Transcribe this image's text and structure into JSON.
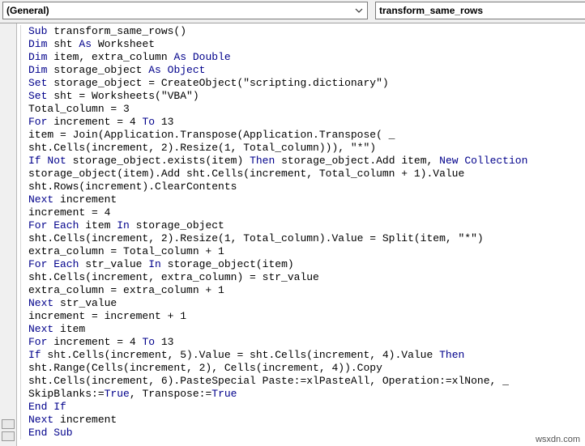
{
  "toolbar": {
    "object_combo_value": "(General)",
    "procedure_combo_value": "transform_same_rows"
  },
  "code_lines": [
    [
      {
        "t": "Sub",
        "k": true
      },
      {
        "t": " transform_same_rows()"
      }
    ],
    [
      {
        "t": "Dim",
        "k": true
      },
      {
        "t": " sht "
      },
      {
        "t": "As",
        "k": true
      },
      {
        "t": " Worksheet"
      }
    ],
    [
      {
        "t": "Dim",
        "k": true
      },
      {
        "t": " item, extra_column "
      },
      {
        "t": "As",
        "k": true
      },
      {
        "t": " "
      },
      {
        "t": "Double",
        "k": true
      }
    ],
    [
      {
        "t": "Dim",
        "k": true
      },
      {
        "t": " storage_object "
      },
      {
        "t": "As",
        "k": true
      },
      {
        "t": " "
      },
      {
        "t": "Object",
        "k": true
      }
    ],
    [
      {
        "t": "Set",
        "k": true
      },
      {
        "t": " storage_object = CreateObject(\"scripting.dictionary\")"
      }
    ],
    [
      {
        "t": "Set",
        "k": true
      },
      {
        "t": " sht = Worksheets(\"VBA\")"
      }
    ],
    [
      {
        "t": "Total_column = 3"
      }
    ],
    [
      {
        "t": "For",
        "k": true
      },
      {
        "t": " increment = 4 "
      },
      {
        "t": "To",
        "k": true
      },
      {
        "t": " 13"
      }
    ],
    [
      {
        "t": "item = Join(Application.Transpose(Application.Transpose( _"
      }
    ],
    [
      {
        "t": "sht.Cells(increment, 2).Resize(1, Total_column))), \"*\")"
      }
    ],
    [
      {
        "t": "If",
        "k": true
      },
      {
        "t": " "
      },
      {
        "t": "Not",
        "k": true
      },
      {
        "t": " storage_object.exists(item) "
      },
      {
        "t": "Then",
        "k": true
      },
      {
        "t": " storage_object.Add item, "
      },
      {
        "t": "New",
        "k": true
      },
      {
        "t": " "
      },
      {
        "t": "Collection",
        "k": true
      }
    ],
    [
      {
        "t": "storage_object(item).Add sht.Cells(increment, Total_column + 1).Value"
      }
    ],
    [
      {
        "t": "sht.Rows(increment).ClearContents"
      }
    ],
    [
      {
        "t": "Next",
        "k": true
      },
      {
        "t": " increment"
      }
    ],
    [
      {
        "t": "increment = 4"
      }
    ],
    [
      {
        "t": "For Each",
        "k": true
      },
      {
        "t": " item "
      },
      {
        "t": "In",
        "k": true
      },
      {
        "t": " storage_object"
      }
    ],
    [
      {
        "t": "sht.Cells(increment, 2).Resize(1, Total_column).Value = Split(item, \"*\")"
      }
    ],
    [
      {
        "t": "extra_column = Total_column + 1"
      }
    ],
    [
      {
        "t": "For Each",
        "k": true
      },
      {
        "t": " str_value "
      },
      {
        "t": "In",
        "k": true
      },
      {
        "t": " storage_object(item)"
      }
    ],
    [
      {
        "t": "sht.Cells(increment, extra_column) = str_value"
      }
    ],
    [
      {
        "t": "extra_column = extra_column + 1"
      }
    ],
    [
      {
        "t": "Next",
        "k": true
      },
      {
        "t": " str_value"
      }
    ],
    [
      {
        "t": "increment = increment + 1"
      }
    ],
    [
      {
        "t": "Next",
        "k": true
      },
      {
        "t": " item"
      }
    ],
    [
      {
        "t": "For",
        "k": true
      },
      {
        "t": " increment = 4 "
      },
      {
        "t": "To",
        "k": true
      },
      {
        "t": " 13"
      }
    ],
    [
      {
        "t": "If",
        "k": true
      },
      {
        "t": " sht.Cells(increment, 5).Value = sht.Cells(increment, 4).Value "
      },
      {
        "t": "Then",
        "k": true
      }
    ],
    [
      {
        "t": "sht.Range(Cells(increment, 2), Cells(increment, 4)).Copy"
      }
    ],
    [
      {
        "t": "sht.Cells(increment, 6).PasteSpecial Paste:=xlPasteAll, Operation:=xlNone, _"
      }
    ],
    [
      {
        "t": "SkipBlanks:="
      },
      {
        "t": "True",
        "k": true
      },
      {
        "t": ", Transpose:="
      },
      {
        "t": "True",
        "k": true
      }
    ],
    [
      {
        "t": "End If",
        "k": true
      }
    ],
    [
      {
        "t": "Next",
        "k": true
      },
      {
        "t": " increment"
      }
    ],
    [
      {
        "t": "End Sub",
        "k": true
      }
    ]
  ],
  "watermark": "wsxdn.com",
  "colors": {
    "keyword": "#00008b",
    "text": "#000000",
    "background": "#ffffff",
    "chrome": "#f0f0f0"
  }
}
